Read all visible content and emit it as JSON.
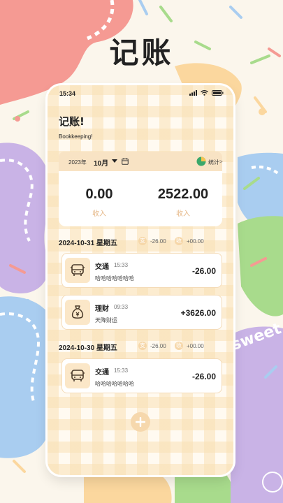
{
  "hero_title": "记账",
  "status_bar": {
    "time": "15:34"
  },
  "app": {
    "title": "记账!",
    "subtitle": "Bookkeeping!"
  },
  "month_bar": {
    "year": "2023年",
    "month": "10月",
    "stats_label": "统计",
    "stats_chevron": ">"
  },
  "summary": {
    "expense_amount": "0.00",
    "expense_label": "收入",
    "income_amount": "2522.00",
    "income_label": "收入"
  },
  "days": [
    {
      "date": "2024-10-31 星期五",
      "expense_badge": "支",
      "expense_total": "-26.00",
      "income_badge": "收",
      "income_total": "+00.00",
      "records": [
        {
          "icon": "bus-icon",
          "category": "交通",
          "time": "15:33",
          "note": "哈哈哈哈哈哈哈",
          "amount": "-26.00"
        },
        {
          "icon": "money-bag-icon",
          "category": "理财",
          "time": "09:33",
          "note": "天降财运",
          "amount": "+3626.00"
        }
      ]
    },
    {
      "date": "2024-10-30 星期五",
      "expense_badge": "支",
      "expense_total": "-26.00",
      "income_badge": "收",
      "income_total": "+00.00",
      "records": [
        {
          "icon": "bus-icon",
          "category": "交通",
          "time": "15:33",
          "note": "哈哈哈哈哈哈哈",
          "amount": "-26.00"
        }
      ]
    }
  ],
  "watermark": "sweet",
  "colors": {
    "accent": "#f6d8ad",
    "label": "#e6b989",
    "card_border": "#f4dbb8"
  }
}
